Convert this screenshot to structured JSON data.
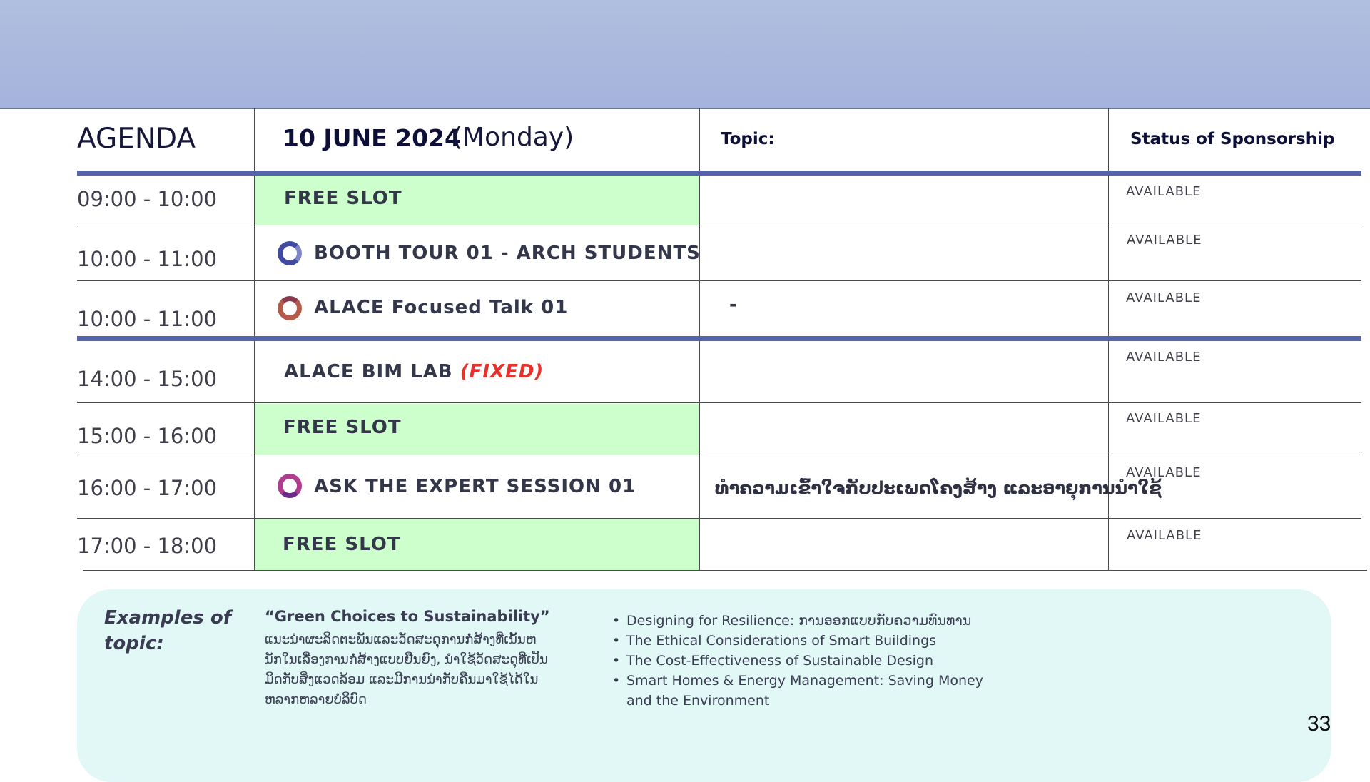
{
  "header": {
    "agenda_label": "AGENDA",
    "date": "10 JUNE 2024",
    "day": "(Monday)",
    "topic_label": "Topic:",
    "status_label": "Status of Sponsorship"
  },
  "rows": [
    {
      "time": "09:00 - 10:00",
      "title": "FREE SLOT",
      "topic": "",
      "status": "AVAILABLE"
    },
    {
      "time": "10:00 - 11:00",
      "title": "BOOTH TOUR 01 - ARCH STUDENTS",
      "topic": "",
      "status": "AVAILABLE"
    },
    {
      "time": "10:00 - 11:00",
      "title": "ALACE Focused Talk 01",
      "topic": "-",
      "status": "AVAILABLE"
    },
    {
      "time": "14:00 - 15:00",
      "title": "ALACE BIM LAB",
      "title_tag": "(FIXED)",
      "topic": "",
      "status": "AVAILABLE"
    },
    {
      "time": "15:00 - 16:00",
      "title": "FREE SLOT",
      "topic": "",
      "status": "AVAILABLE"
    },
    {
      "time": "16:00 - 17:00",
      "title": "ASK THE EXPERT SESSION 01",
      "topic": "ທຳຄວາມເຂົ້າໃຈກັບປະເພດໂຄງສ້າງ ແລະອາຍຸການນຳໃຊ້",
      "status": "AVAILABLE"
    },
    {
      "time": "17:00 - 18:00",
      "title": "FREE SLOT",
      "topic": "",
      "status": "AVAILABLE"
    }
  ],
  "colors": {
    "free_slot": "#ccffcc",
    "divider": "#5563aa",
    "fixed_tag": "#e8312d",
    "panel": "#e1f8f6",
    "ring_booth": "#3f4aa0",
    "ring_talk": "#b45a4a",
    "ring_expert": "#b03c8e"
  },
  "icons": {
    "booth": "ring-icon",
    "talk": "ring-icon",
    "expert": "ring-icon"
  },
  "examples": {
    "label": "Examples of topic:",
    "title": "“Green Choices to Sustainability”",
    "description": "ແນະນຳຜະລິດຕະພັນແລະວັດສະດຸການກໍ່ສ້າງທີ່ເນັ້ນຫນັກໃນເລື່ອງການກໍ່ສ້າງແບບຍືນຍົງ, ນຳໃຊ້ວັດສະດຸທີ່ເປັນມິດກັບສິ່ງແວດລ້ອມ ແລະມີການນຳກັບຄືນມາໃຊ້ໄດ້ໃນຫລາກຫລາຍບໍລິບົດ",
    "items": [
      "Designing for Resilience: ການອອກແບບກັບຄວາມທົນທານ",
      "The Ethical Considerations of Smart Buildings",
      " The Cost-Effectiveness of Sustainable Design",
      "Smart Homes & Energy Management: Saving Money and the Environment"
    ]
  },
  "page_number": "33"
}
